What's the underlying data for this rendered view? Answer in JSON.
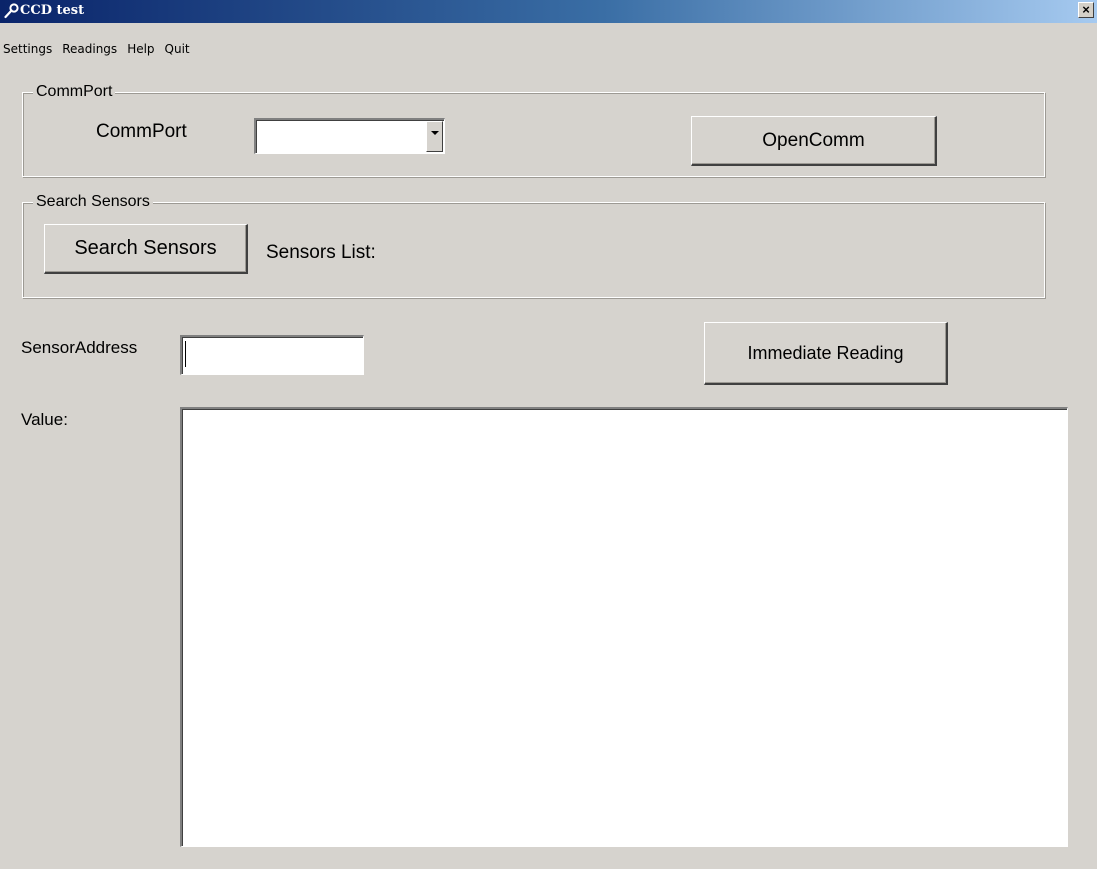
{
  "window": {
    "title": "CCD test",
    "close_glyph": "×"
  },
  "menu": [
    "Settings",
    "Readings",
    "Help",
    "Quit"
  ],
  "commport_group": {
    "legend": "CommPort",
    "label": "CommPort",
    "select_value": "",
    "open_button": "OpenComm"
  },
  "search_group": {
    "legend": "Search Sensors",
    "search_button": "Search Sensors",
    "sensors_list_label": "Sensors List:"
  },
  "sensor": {
    "address_label": "SensorAddress",
    "address_value": "",
    "reading_button": "Immediate Reading",
    "value_label": "Value:",
    "value_text": ""
  },
  "colors": {
    "titlebar_start": "#0a246a",
    "titlebar_end": "#a6caf0",
    "face": "#d6d3ce"
  },
  "icons": {
    "title_icon": "wrench-icon",
    "dropdown_icon": "chevron-down-icon"
  }
}
